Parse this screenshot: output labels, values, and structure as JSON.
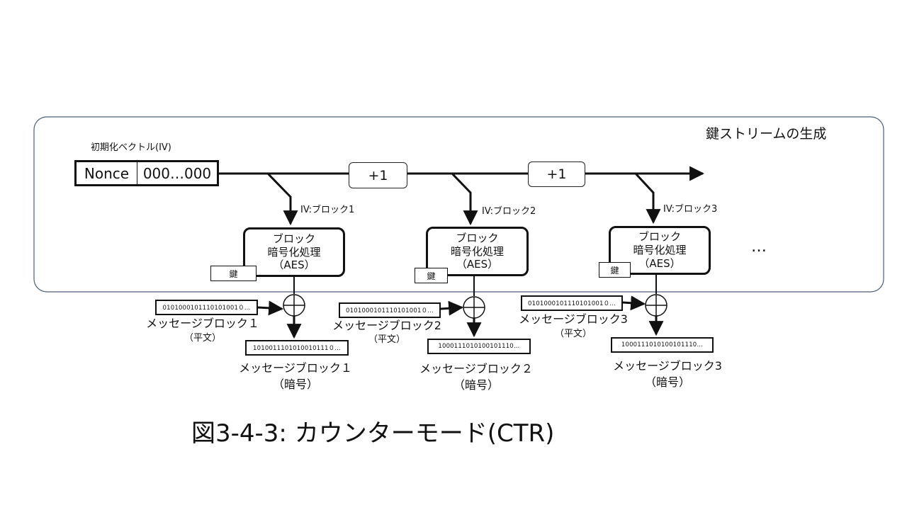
{
  "region_label": "鍵ストリームの生成",
  "iv": {
    "label": "初期化ベクトル(IV)",
    "nonce": "Nonce",
    "counter": "000…000"
  },
  "increment_label": "+1",
  "continuation": "…",
  "blocks": [
    {
      "iv_label": "IV:ブロック1",
      "cipher_line1": "ブロック",
      "cipher_line2": "暗号化処理",
      "cipher_line3": "（AES）",
      "key": "鍵",
      "plain_bits": "0101000101110101001０…",
      "plain_label": "メッセージブロック１",
      "plain_sub": "（平文）",
      "cipher_bits": "1010011101010010111０…",
      "cipher_label": "メッセージブロック１",
      "cipher_sub": "（暗号）"
    },
    {
      "iv_label": "IV:ブロック2",
      "cipher_line1": "ブロック",
      "cipher_line2": "暗号化処理",
      "cipher_line3": "（AES）",
      "key": "鍵",
      "plain_bits": "0101000101110101001０…",
      "plain_label": "メッセージブロック2",
      "plain_sub": "（平文）",
      "cipher_bits": "1000111010100101110…",
      "cipher_label": "メッセージブロック２",
      "cipher_sub": "（暗号）"
    },
    {
      "iv_label": "IV:ブロック3",
      "cipher_line1": "ブロック",
      "cipher_line2": "暗号化処理",
      "cipher_line3": "（AES）",
      "key": "鍵",
      "plain_bits": "0101000101110101001０…",
      "plain_label": "メッセージブロック3",
      "plain_sub": "（平文）",
      "cipher_bits": "1000111010100101110…",
      "cipher_label": "メッセージブロック3",
      "cipher_sub": "（暗号）"
    }
  ],
  "caption": "図3-4-3: カウンターモード(CTR)"
}
